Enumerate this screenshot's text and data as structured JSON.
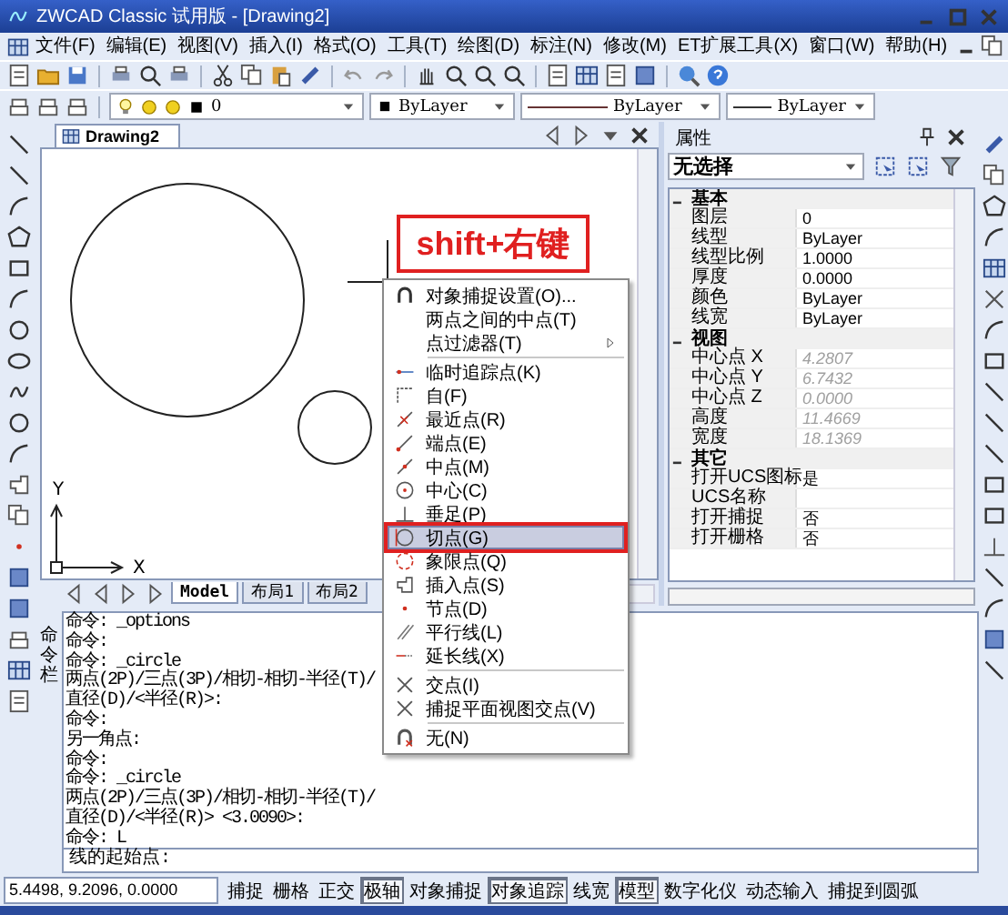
{
  "window": {
    "title": "ZWCAD Classic 试用版 - [Drawing2]"
  },
  "menu_bar": [
    "文件(F)",
    "编辑(E)",
    "视图(V)",
    "插入(I)",
    "格式(O)",
    "工具(T)",
    "绘图(D)",
    "标注(N)",
    "修改(M)",
    "ET扩展工具(X)",
    "窗口(W)",
    "帮助(H)"
  ],
  "layer_toolbar": {
    "layer": "0",
    "plot_color": "ByLayer",
    "linetype": "ByLayer",
    "lineweight": "ByLayer"
  },
  "document_tab": {
    "title": "Drawing2"
  },
  "canvas": {
    "x_label": "X",
    "y_label": "Y"
  },
  "layout_tabs": [
    {
      "label": "Model",
      "selected": true
    },
    {
      "label": "布局1",
      "selected": false
    },
    {
      "label": "布局2",
      "selected": false
    }
  ],
  "annotation": "shift+右键",
  "context_menu": {
    "groups": [
      [
        {
          "label": "对象捕捉设置(O)...",
          "selected": false,
          "submenu": false
        },
        {
          "label": "两点之间的中点(T)",
          "selected": false,
          "submenu": false
        },
        {
          "label": "点过滤器(T)",
          "selected": false,
          "submenu": true
        }
      ],
      [
        {
          "label": "临时追踪点(K)",
          "selected": false,
          "submenu": false
        },
        {
          "label": "自(F)",
          "selected": false,
          "submenu": false
        },
        {
          "label": "最近点(R)",
          "selected": false,
          "submenu": false
        },
        {
          "label": "端点(E)",
          "selected": false,
          "submenu": false
        },
        {
          "label": "中点(M)",
          "selected": false,
          "submenu": false
        },
        {
          "label": "中心(C)",
          "selected": false,
          "submenu": false
        },
        {
          "label": "垂足(P)",
          "selected": false,
          "submenu": false
        },
        {
          "label": "切点(G)",
          "selected": true,
          "submenu": false
        },
        {
          "label": "象限点(Q)",
          "selected": false,
          "submenu": false
        },
        {
          "label": "插入点(S)",
          "selected": false,
          "submenu": false
        },
        {
          "label": "节点(D)",
          "selected": false,
          "submenu": false
        },
        {
          "label": "平行线(L)",
          "selected": false,
          "submenu": false
        },
        {
          "label": "延长线(X)",
          "selected": false,
          "submenu": false
        }
      ],
      [
        {
          "label": "交点(I)",
          "selected": false,
          "submenu": false
        },
        {
          "label": "捕捉平面视图交点(V)",
          "selected": false,
          "submenu": false
        }
      ],
      [
        {
          "label": "无(N)",
          "selected": false,
          "submenu": false
        }
      ]
    ]
  },
  "properties": {
    "title": "属性",
    "selection": "无选择",
    "sections": [
      {
        "name": "基本",
        "expanded": true,
        "rows": [
          {
            "name": "图层",
            "value": "0",
            "disabled": false
          },
          {
            "name": "线型",
            "value": "ByLayer",
            "disabled": false
          },
          {
            "name": "线型比例",
            "value": "1.0000",
            "disabled": false
          },
          {
            "name": "厚度",
            "value": "0.0000",
            "disabled": false
          },
          {
            "name": "颜色",
            "value": "ByLayer",
            "disabled": false
          },
          {
            "name": "线宽",
            "value": "ByLayer",
            "disabled": false
          }
        ]
      },
      {
        "name": "视图",
        "expanded": true,
        "rows": [
          {
            "name": "中心点 X",
            "value": "4.2807",
            "disabled": true
          },
          {
            "name": "中心点 Y",
            "value": "6.7432",
            "disabled": true
          },
          {
            "name": "中心点 Z",
            "value": "0.0000",
            "disabled": true
          },
          {
            "name": "高度",
            "value": "11.4669",
            "disabled": true
          },
          {
            "name": "宽度",
            "value": "18.1369",
            "disabled": true
          }
        ]
      },
      {
        "name": "其它",
        "expanded": true,
        "rows": [
          {
            "name": "打开UCS图标",
            "value": "是",
            "disabled": false
          },
          {
            "name": "UCS名称"
          },
          {
            "name": "打开捕捉",
            "value": "否",
            "disabled": false
          },
          {
            "name": "打开栅格",
            "value": "否",
            "disabled": false
          }
        ]
      }
    ]
  },
  "command_window": {
    "title": "命令栏",
    "history": [
      "命令: _options",
      "命令:",
      "命令: _circle",
      "两点(2P)/三点(3P)/相切-相切-半径(T)/",
      "直径(D)/<半径(R)>:",
      "命令:",
      "另一角点:",
      "命令:",
      "命令: _circle",
      "两点(2P)/三点(3P)/相切-相切-半径(T)/",
      "直径(D)/<半径(R)> <3.0090>:",
      "命令: L"
    ],
    "prompt": "线的起始点:"
  },
  "status_bar": {
    "coordinates": "5.4498,  9.2096,  0.0000",
    "toggles": [
      {
        "label": "捕捉",
        "on": false
      },
      {
        "label": "栅格",
        "on": false
      },
      {
        "label": "正交",
        "on": false
      },
      {
        "label": "极轴",
        "on": true
      },
      {
        "label": "对象捕捉",
        "on": false
      },
      {
        "label": "对象追踪",
        "on": true
      },
      {
        "label": "线宽",
        "on": false
      },
      {
        "label": "模型",
        "on": true
      },
      {
        "label": "数字化仪",
        "on": false
      },
      {
        "label": "动态输入",
        "on": false
      },
      {
        "label": "捕捉到圆弧",
        "on": false
      }
    ]
  }
}
